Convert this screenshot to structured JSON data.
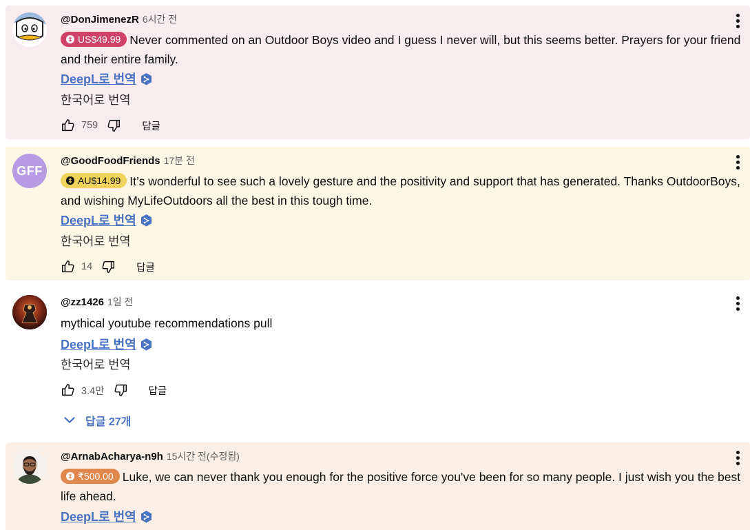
{
  "deepl_label": "DeepL로 번역",
  "translate_label": "한국어로 번역",
  "reply_label": "답글",
  "comments": [
    {
      "author": "@DonJimenezR",
      "time": "6시간 전",
      "super_chat": "US$49.99",
      "text": "Never commented on an Outdoor Boys video and I guess I never will, but this seems better. Prayers for your friend and  their entire family.",
      "likes": "759",
      "bg_color": "#f8ecee",
      "chip_color": "#d04368"
    },
    {
      "author": "@GoodFoodFriends",
      "time": "17분 전",
      "avatar_text": "GFF",
      "super_chat": "AU$14.99",
      "text": "It’s wonderful to see such a lovely gesture and the positivity and support that has generated. Thanks OutdoorBoys, and wishing MyLifeOutdoors all the best in this tough time.",
      "likes": "14",
      "bg_color": "#fdf6e4",
      "chip_color": "#efd35c"
    },
    {
      "author": "@zz1426",
      "time": "1일 전",
      "text": "mythical youtube recommendations pull",
      "likes": "3.4만",
      "replies_label": "답글 27개"
    },
    {
      "author": "@ArnabAcharya-n9h",
      "time": "15시간 전(수정됨)",
      "super_chat": "₹500.00",
      "text": "Luke, we can never thank you enough for the positive force you've been for so many people. I just wish you the best life ahead.",
      "bg_color": "#fbefe5",
      "chip_color": "#e0884d"
    }
  ],
  "icons": {
    "like": "thumbs-up-icon",
    "dislike": "thumbs-down-icon",
    "more": "more-vert-icon",
    "deepl": "deepl-icon",
    "chip": "super-chat-icon",
    "expand": "chevron-down-icon"
  },
  "colors": {
    "link": "#4a72c2",
    "muted": "#606060"
  }
}
